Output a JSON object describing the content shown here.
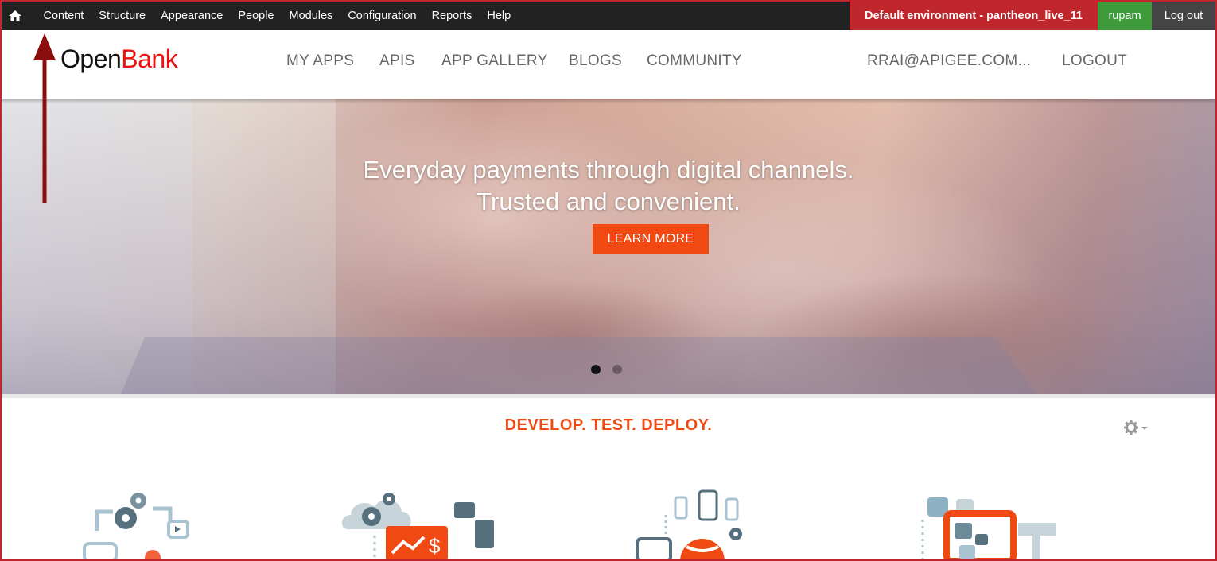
{
  "admin_bar": {
    "home_icon": "home-icon",
    "menu": [
      "Content",
      "Structure",
      "Appearance",
      "People",
      "Modules",
      "Configuration",
      "Reports",
      "Help"
    ],
    "environment": "Default environment - pantheon_live_11",
    "username": "rupam",
    "logout": "Log out",
    "colors": {
      "bar": "#222222",
      "environment": "#c0272d",
      "user": "#3e9b3b"
    }
  },
  "header": {
    "logo_open": "Open",
    "logo_bank": "Bank",
    "nav": [
      "MY APPS",
      "APIS",
      "APP GALLERY",
      "BLOGS",
      "COMMUNITY"
    ],
    "user_email": "RRAI@APIGEE.COM...",
    "logout": "LOGOUT"
  },
  "hero": {
    "line1": "Everyday payments through digital channels.",
    "line2": "Trusted and convenient.",
    "cta": "LEARN MORE",
    "slides_total": 2,
    "active_slide": 1,
    "accent": "#f04a12"
  },
  "tagline": "DEVELOP. TEST. DEPLOY.",
  "features_icons": [
    "gears-workflow-icon",
    "cloud-analytics-icon",
    "devices-api-icon",
    "tablet-blocks-icon"
  ]
}
